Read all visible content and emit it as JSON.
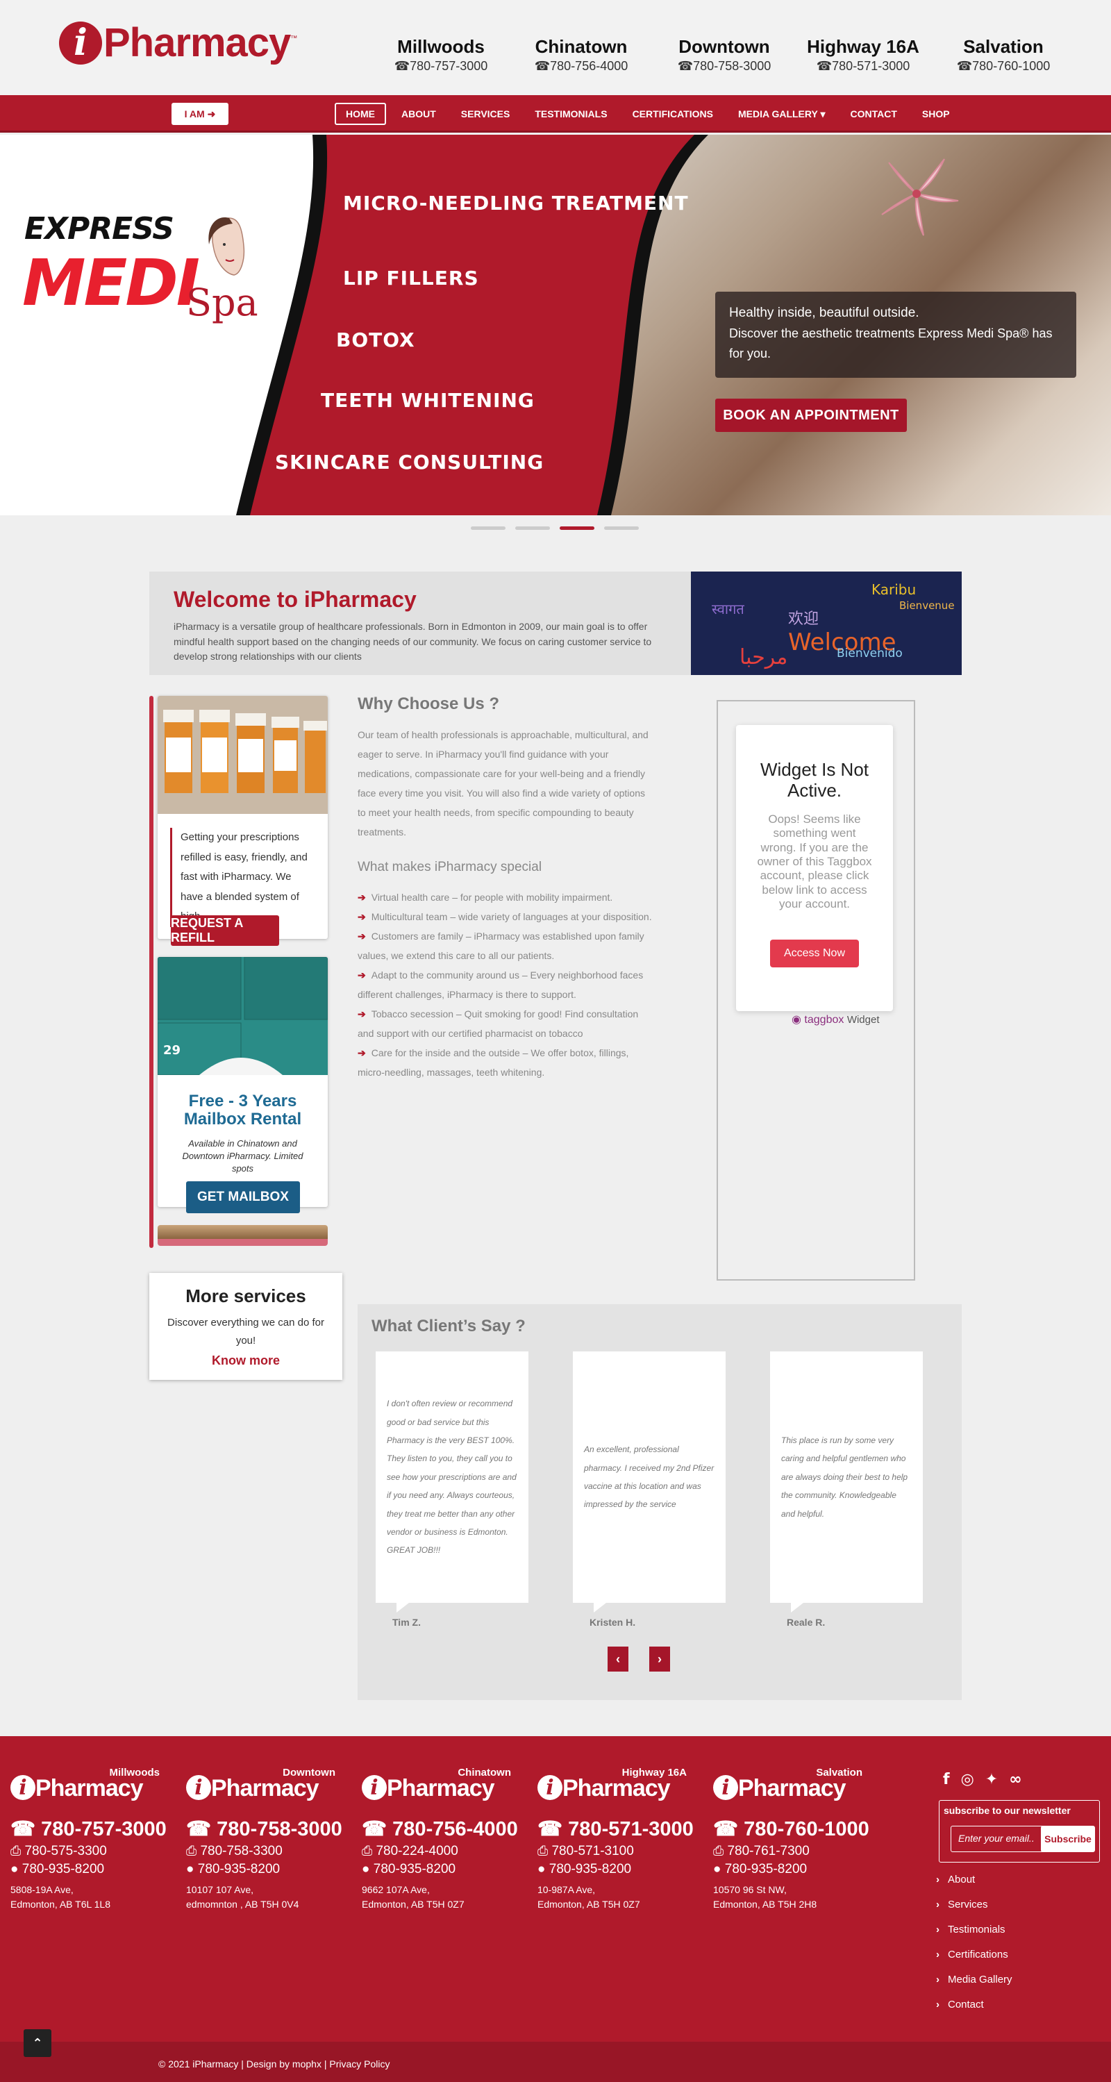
{
  "header": {
    "logo": {
      "letter": "i",
      "text": "Pharmacy",
      "tm": "™"
    },
    "locations": [
      {
        "name": "Millwoods",
        "phone": "☎780-757-3000"
      },
      {
        "name": "Chinatown",
        "phone": "☎780-756-4000"
      },
      {
        "name": "Downtown",
        "phone": "☎780-758-3000"
      },
      {
        "name": "Highway 16A",
        "phone": "☎780-571-3000"
      },
      {
        "name": "Salvation",
        "phone": "☎780-760-1000"
      }
    ]
  },
  "nav": {
    "iam_label": "I AM ➜",
    "items": [
      "HOME",
      "ABOUT",
      "SERVICES",
      "TESTIMONIALS",
      "CERTIFICATIONS",
      "MEDIA GALLERY ▾",
      "CONTACT",
      "SHOP"
    ],
    "active_index": 0
  },
  "hero": {
    "brand_express": "EXPRESS",
    "brand_medi": "MEDI",
    "brand_spa": "Spa",
    "treatments": [
      "MICRO-NEEDLING TREATMENT",
      "LIP FILLERS",
      "BOTOX",
      "TEETH WHITENING",
      "SKINCARE CONSULTING"
    ],
    "caption_line1": "Healthy inside, beautiful outside.",
    "caption_line2": "Discover the aesthetic treatments Express Medi Spa® has for you.",
    "book_label": "BOOK AN APPOINTMENT",
    "slide_count": 4,
    "active_slide": 2
  },
  "welcome": {
    "title": "Welcome to iPharmacy",
    "text": "iPharmacy is a versatile group of healthcare professionals. Born in Edmonton in 2009, our main goal is to offer mindful health support based on the changing needs of our community. We focus on caring customer service to develop strong relationships with our clients",
    "image_words": [
      "Welcome",
      "Karibu",
      "Bienvenue",
      "Bienvenido",
      "欢迎",
      "مرحبا",
      "स्वागत"
    ]
  },
  "refill_card": {
    "text": "Getting your prescriptions refilled is easy, friendly, and fast with iPharmacy. We have a blended system of high-",
    "button": "REQUEST A REFILL"
  },
  "mailbox_card": {
    "locker_number": "29",
    "title": "Free - 3 Years Mailbox Rental",
    "text": "Available in Chinatown and Downtown iPharmacy. Limited spots",
    "button": "GET MAILBOX"
  },
  "more_services": {
    "title": "More services",
    "text": "Discover everything we can do for you!",
    "link": "Know more"
  },
  "why": {
    "title": "Why Choose Us ?",
    "text": "Our team of health professionals is approachable, multicultural, and eager to serve. In iPharmacy you'll find guidance with your medications, compassionate care for your well-being and a friendly face every time you visit. You will also find a wide variety of options to meet your health needs, from specific compounding to beauty treatments.",
    "special_title": "What makes iPharmacy special",
    "points": [
      "Virtual health care – for people with mobility impairment.",
      "Multicultural team – wide variety of languages at your disposition.",
      "Customers are family – iPharmacy was established upon family values, we extend this care to all our patients.",
      "Adapt to the community around us – Every neighborhood faces different challenges, iPharmacy is there to support.",
      "Tobacco secession – Quit smoking for good! Find consultation and support with our certified pharmacist on tobacco",
      "Care for the inside and the outside – We offer botox, fillings, micro-needling, massages, teeth whitening."
    ]
  },
  "widget": {
    "title": "Widget Is Not Active.",
    "text": "Oops! Seems like something went wrong. If you are the owner of this Taggbox account, please click below link to access your account.",
    "button": "Access Now",
    "brand": "taggbox",
    "brand_suffix": "Widget"
  },
  "testimonials": {
    "title": "What Client’s Say ?",
    "items": [
      {
        "text": "I don't often review or recommend good or bad service but this Pharmacy is the very BEST 100%. They listen to you, they call you to see how your prescriptions are and if you need any. Always courteous, they treat me better than any other vendor or business is Edmonton. GREAT JOB!!!",
        "name": "Tim Z."
      },
      {
        "text": "An excellent, professional pharmacy. I received my 2nd Pfizer vaccine at this location and was impressed by the service",
        "name": "Kristen H."
      },
      {
        "text": "This place is run by some very caring and helpful gentlemen who are always doing their best to help the community. Knowledgeable and helpful.",
        "name": "Reale R."
      }
    ],
    "prev": "‹",
    "next": "›"
  },
  "footer": {
    "locations": [
      {
        "name": "Millwoods",
        "big": "☎ 780-757-3000",
        "fax": "⎙ 780-575-3300",
        "chat": "● 780-935-8200",
        "addr1": "5808-19A Ave,",
        "addr2": "Edmonton, AB T6L 1L8"
      },
      {
        "name": "Downtown",
        "big": "☎ 780-758-3000",
        "fax": "⎙ 780-758-3300",
        "chat": "● 780-935-8200",
        "addr1": "10107 107 Ave,",
        "addr2": "edmomnton , AB T5H 0V4"
      },
      {
        "name": "Chinatown",
        "big": "☎ 780-756-4000",
        "fax": "⎙ 780-224-4000",
        "chat": "● 780-935-8200",
        "addr1": "9662 107A Ave,",
        "addr2": "Edmonton, AB T5H 0Z7"
      },
      {
        "name": "Highway 16A",
        "big": "☎ 780-571-3000",
        "fax": "⎙ 780-571-3100",
        "chat": "● 780-935-8200",
        "addr1": "10-987A Ave,",
        "addr2": "Edmonton, AB T5H 0Z7"
      },
      {
        "name": "Salvation",
        "big": "☎ 780-760-1000",
        "fax": "⎙ 780-761-7300",
        "chat": "● 780-935-8200",
        "addr1": "10570 96 St NW,",
        "addr2": "Edmonton, AB T5H 2H8"
      }
    ],
    "social_icons": [
      "facebook-icon",
      "instagram-icon",
      "twitter-icon",
      "tripadvisor-icon"
    ],
    "newsletter_title": "subscribe to our newsletter",
    "newsletter_placeholder": "Enter your email..",
    "subscribe_label": "Subscribe",
    "links": [
      "About",
      "Services",
      "Testimonials",
      "Certifications",
      "Media Gallery",
      "Contact"
    ],
    "copyright": "© 2021 iPharmacy | Design by mophx | Privacy Policy"
  },
  "colors": {
    "brand_red": "#b01a2b",
    "mailbox_blue": "#1e6a93"
  }
}
